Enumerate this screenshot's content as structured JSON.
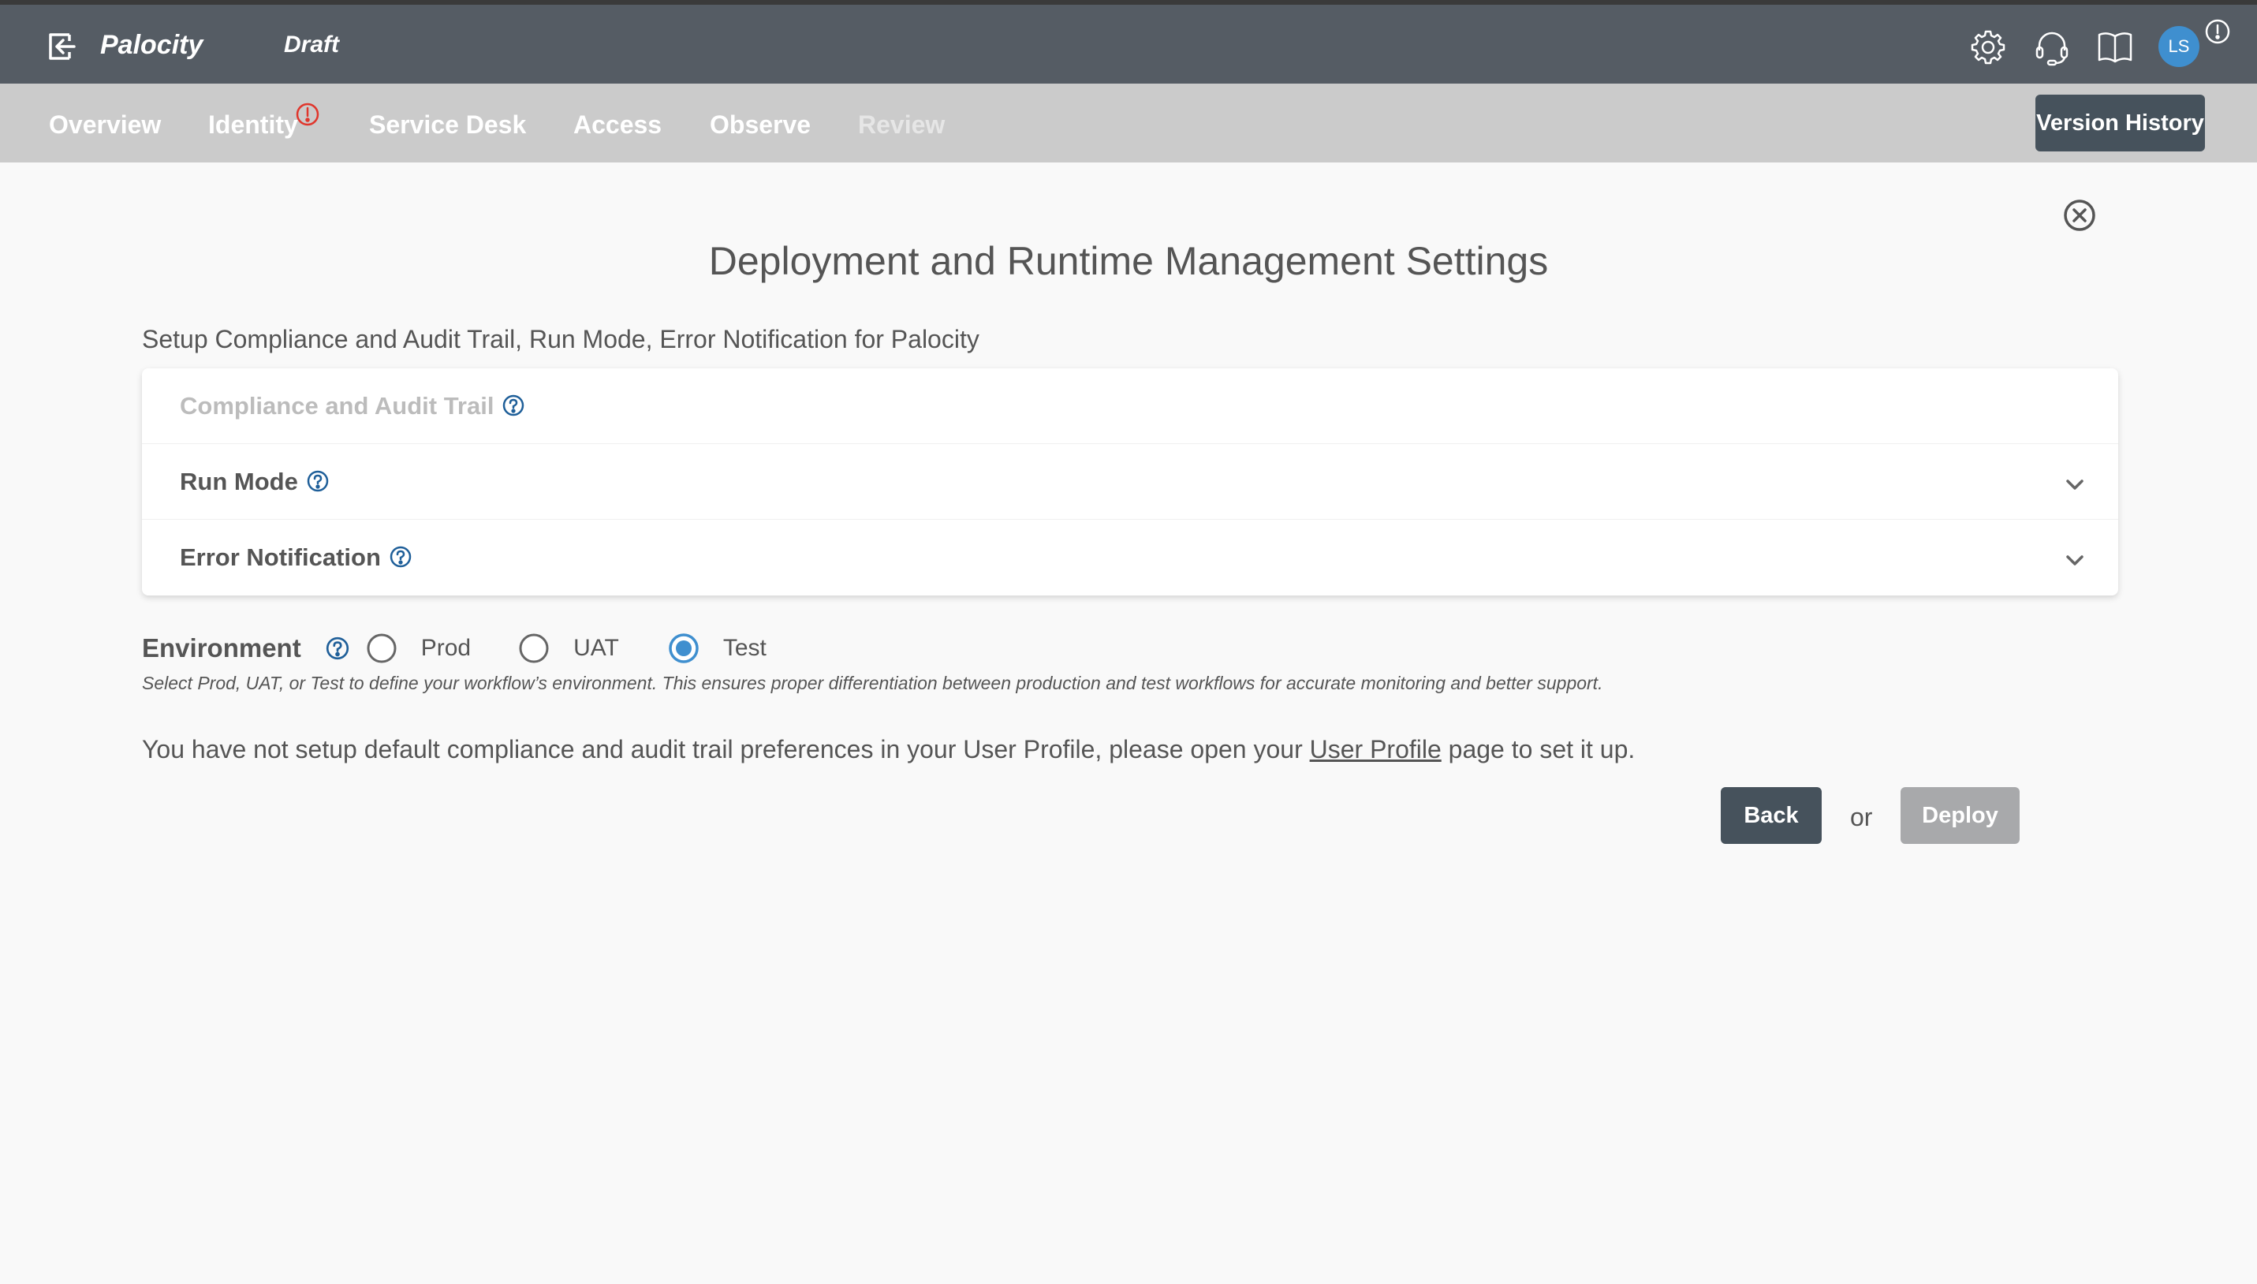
{
  "header": {
    "app_name": "Palocity",
    "status": "Draft",
    "avatar_initials": "LS",
    "icons": [
      "exit-icon",
      "gear-icon",
      "headset-icon",
      "book-icon",
      "alert-icon"
    ]
  },
  "nav": {
    "items": [
      {
        "label": "Overview",
        "disabled": false
      },
      {
        "label": "Identity",
        "disabled": false,
        "badge": "!"
      },
      {
        "label": "Service Desk",
        "disabled": false
      },
      {
        "label": "Access",
        "disabled": false
      },
      {
        "label": "Observe",
        "disabled": false
      },
      {
        "label": "Review",
        "disabled": true
      }
    ],
    "version_history_label": "Version History"
  },
  "main": {
    "title": "Deployment and Runtime Management Settings",
    "subtitle": "Setup Compliance and Audit Trail, Run Mode, Error Notification for Palocity",
    "sections": [
      {
        "label": "Compliance and Audit Trail",
        "disabled": true,
        "expandable": false
      },
      {
        "label": "Run Mode",
        "disabled": false,
        "expandable": true
      },
      {
        "label": "Error Notification",
        "disabled": false,
        "expandable": true
      }
    ],
    "environment": {
      "label": "Environment",
      "options": [
        "Prod",
        "UAT",
        "Test"
      ],
      "selected": "Test",
      "help_text": "Select Prod, UAT, or Test to define your workflow’s environment. This ensures proper differentiation between production and test workflows for accurate monitoring and better support."
    },
    "message": {
      "before_link": "You have not setup default compliance and audit trail preferences in your User Profile, please open your ",
      "link_text": "User Profile",
      "after_link": " page to set it up."
    },
    "actions": {
      "back_label": "Back",
      "or_label": "or",
      "deploy_label": "Deploy",
      "deploy_disabled": true
    }
  },
  "colors": {
    "topbar": "#555c64",
    "navbar": "#cbcbcb",
    "primary_button": "#46525c",
    "disabled_button": "#a8a9ab",
    "help_icon": "#1f5f99",
    "radio_selected": "#3f8fcf",
    "alert_red": "#e0362c",
    "avatar": "#3f8fcf"
  }
}
